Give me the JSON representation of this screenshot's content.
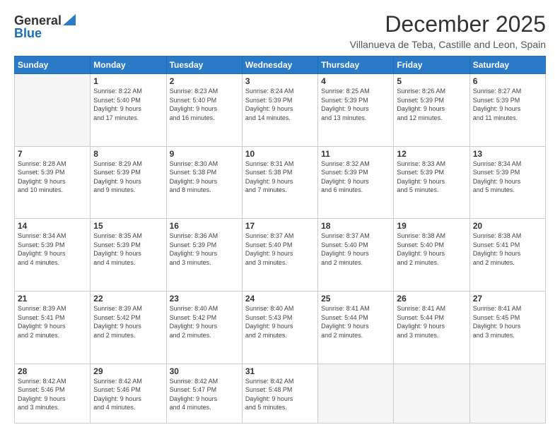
{
  "logo": {
    "general": "General",
    "blue": "Blue"
  },
  "header": {
    "month": "December 2025",
    "location": "Villanueva de Teba, Castille and Leon, Spain"
  },
  "days_of_week": [
    "Sunday",
    "Monday",
    "Tuesday",
    "Wednesday",
    "Thursday",
    "Friday",
    "Saturday"
  ],
  "weeks": [
    [
      {
        "day": "",
        "info": ""
      },
      {
        "day": "1",
        "info": "Sunrise: 8:22 AM\nSunset: 5:40 PM\nDaylight: 9 hours\nand 17 minutes."
      },
      {
        "day": "2",
        "info": "Sunrise: 8:23 AM\nSunset: 5:40 PM\nDaylight: 9 hours\nand 16 minutes."
      },
      {
        "day": "3",
        "info": "Sunrise: 8:24 AM\nSunset: 5:39 PM\nDaylight: 9 hours\nand 14 minutes."
      },
      {
        "day": "4",
        "info": "Sunrise: 8:25 AM\nSunset: 5:39 PM\nDaylight: 9 hours\nand 13 minutes."
      },
      {
        "day": "5",
        "info": "Sunrise: 8:26 AM\nSunset: 5:39 PM\nDaylight: 9 hours\nand 12 minutes."
      },
      {
        "day": "6",
        "info": "Sunrise: 8:27 AM\nSunset: 5:39 PM\nDaylight: 9 hours\nand 11 minutes."
      }
    ],
    [
      {
        "day": "7",
        "info": "Sunrise: 8:28 AM\nSunset: 5:39 PM\nDaylight: 9 hours\nand 10 minutes."
      },
      {
        "day": "8",
        "info": "Sunrise: 8:29 AM\nSunset: 5:39 PM\nDaylight: 9 hours\nand 9 minutes."
      },
      {
        "day": "9",
        "info": "Sunrise: 8:30 AM\nSunset: 5:38 PM\nDaylight: 9 hours\nand 8 minutes."
      },
      {
        "day": "10",
        "info": "Sunrise: 8:31 AM\nSunset: 5:38 PM\nDaylight: 9 hours\nand 7 minutes."
      },
      {
        "day": "11",
        "info": "Sunrise: 8:32 AM\nSunset: 5:39 PM\nDaylight: 9 hours\nand 6 minutes."
      },
      {
        "day": "12",
        "info": "Sunrise: 8:33 AM\nSunset: 5:39 PM\nDaylight: 9 hours\nand 5 minutes."
      },
      {
        "day": "13",
        "info": "Sunrise: 8:34 AM\nSunset: 5:39 PM\nDaylight: 9 hours\nand 5 minutes."
      }
    ],
    [
      {
        "day": "14",
        "info": "Sunrise: 8:34 AM\nSunset: 5:39 PM\nDaylight: 9 hours\nand 4 minutes."
      },
      {
        "day": "15",
        "info": "Sunrise: 8:35 AM\nSunset: 5:39 PM\nDaylight: 9 hours\nand 4 minutes."
      },
      {
        "day": "16",
        "info": "Sunrise: 8:36 AM\nSunset: 5:39 PM\nDaylight: 9 hours\nand 3 minutes."
      },
      {
        "day": "17",
        "info": "Sunrise: 8:37 AM\nSunset: 5:40 PM\nDaylight: 9 hours\nand 3 minutes."
      },
      {
        "day": "18",
        "info": "Sunrise: 8:37 AM\nSunset: 5:40 PM\nDaylight: 9 hours\nand 2 minutes."
      },
      {
        "day": "19",
        "info": "Sunrise: 8:38 AM\nSunset: 5:40 PM\nDaylight: 9 hours\nand 2 minutes."
      },
      {
        "day": "20",
        "info": "Sunrise: 8:38 AM\nSunset: 5:41 PM\nDaylight: 9 hours\nand 2 minutes."
      }
    ],
    [
      {
        "day": "21",
        "info": "Sunrise: 8:39 AM\nSunset: 5:41 PM\nDaylight: 9 hours\nand 2 minutes."
      },
      {
        "day": "22",
        "info": "Sunrise: 8:39 AM\nSunset: 5:42 PM\nDaylight: 9 hours\nand 2 minutes."
      },
      {
        "day": "23",
        "info": "Sunrise: 8:40 AM\nSunset: 5:42 PM\nDaylight: 9 hours\nand 2 minutes."
      },
      {
        "day": "24",
        "info": "Sunrise: 8:40 AM\nSunset: 5:43 PM\nDaylight: 9 hours\nand 2 minutes."
      },
      {
        "day": "25",
        "info": "Sunrise: 8:41 AM\nSunset: 5:44 PM\nDaylight: 9 hours\nand 2 minutes."
      },
      {
        "day": "26",
        "info": "Sunrise: 8:41 AM\nSunset: 5:44 PM\nDaylight: 9 hours\nand 3 minutes."
      },
      {
        "day": "27",
        "info": "Sunrise: 8:41 AM\nSunset: 5:45 PM\nDaylight: 9 hours\nand 3 minutes."
      }
    ],
    [
      {
        "day": "28",
        "info": "Sunrise: 8:42 AM\nSunset: 5:46 PM\nDaylight: 9 hours\nand 3 minutes."
      },
      {
        "day": "29",
        "info": "Sunrise: 8:42 AM\nSunset: 5:46 PM\nDaylight: 9 hours\nand 4 minutes."
      },
      {
        "day": "30",
        "info": "Sunrise: 8:42 AM\nSunset: 5:47 PM\nDaylight: 9 hours\nand 4 minutes."
      },
      {
        "day": "31",
        "info": "Sunrise: 8:42 AM\nSunset: 5:48 PM\nDaylight: 9 hours\nand 5 minutes."
      },
      {
        "day": "",
        "info": ""
      },
      {
        "day": "",
        "info": ""
      },
      {
        "day": "",
        "info": ""
      }
    ]
  ]
}
